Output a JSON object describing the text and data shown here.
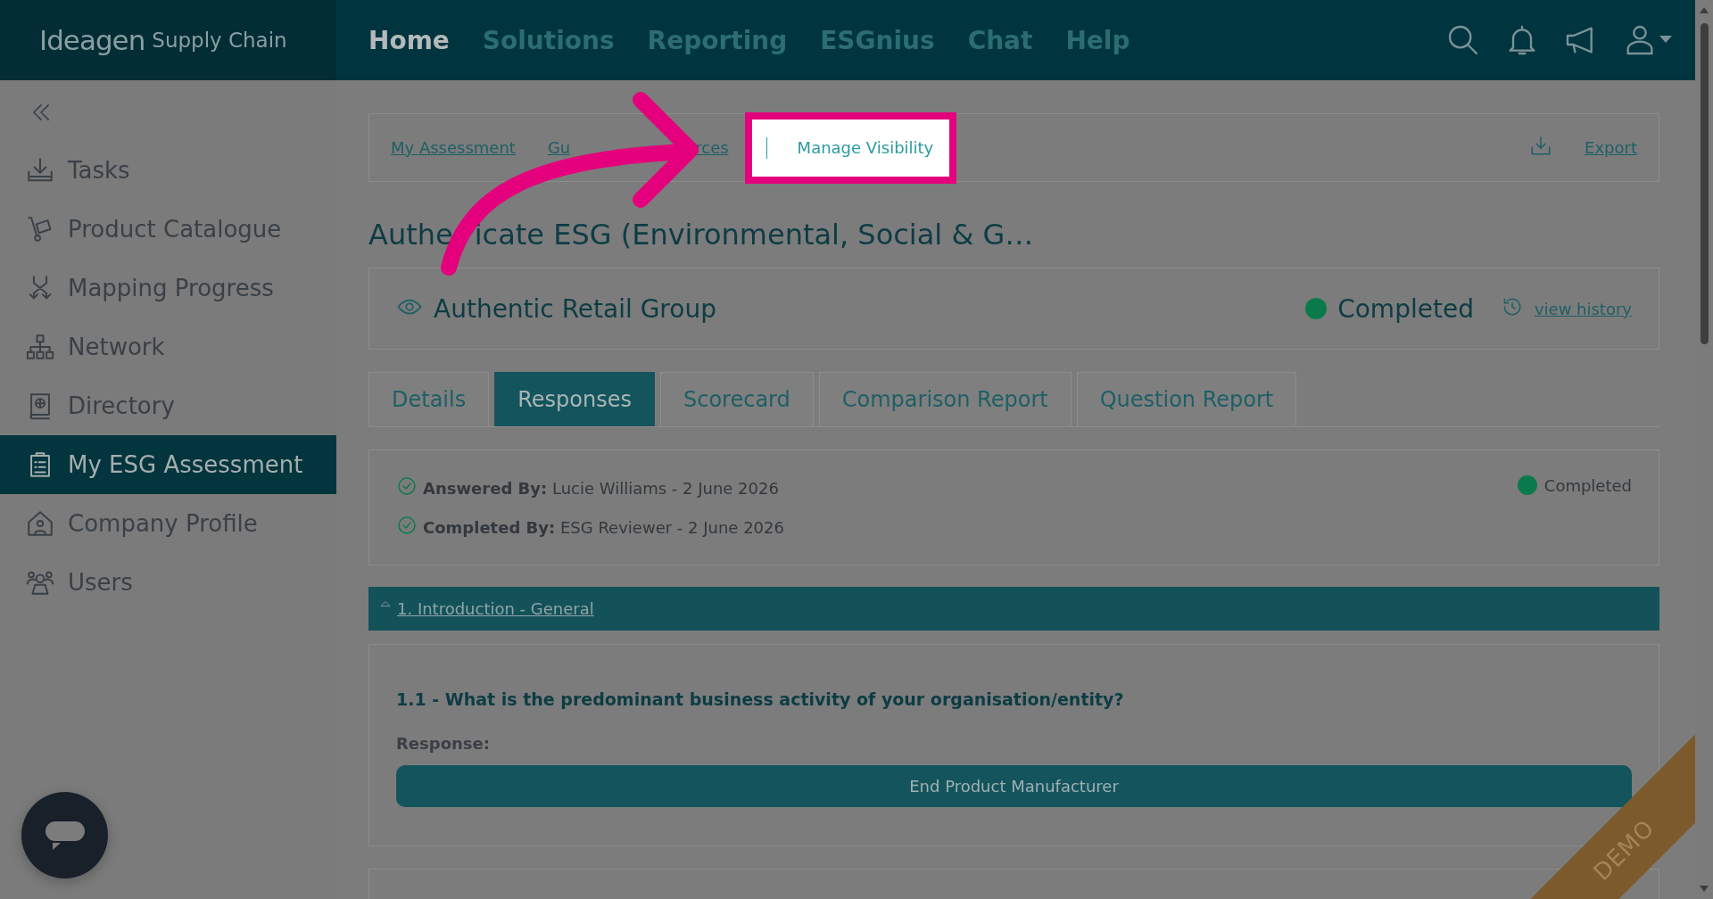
{
  "header": {
    "logo": {
      "brand": "Ideagen",
      "product": "Supply Chain"
    },
    "nav": [
      {
        "label": "Home",
        "selected": true
      },
      {
        "label": "Solutions",
        "selected": false
      },
      {
        "label": "Reporting",
        "selected": false
      },
      {
        "label": "ESGnius",
        "selected": false
      },
      {
        "label": "Chat",
        "selected": false
      },
      {
        "label": "Help",
        "selected": false
      }
    ]
  },
  "sidebar": {
    "items": [
      {
        "label": "Tasks",
        "selected": false
      },
      {
        "label": "Product Catalogue",
        "selected": false
      },
      {
        "label": "Mapping Progress",
        "selected": false
      },
      {
        "label": "Network",
        "selected": false
      },
      {
        "label": "Directory",
        "selected": false
      },
      {
        "label": "My ESG Assessment",
        "selected": true
      },
      {
        "label": "Company Profile",
        "selected": false
      },
      {
        "label": "Users",
        "selected": false
      }
    ]
  },
  "breadcrumb": {
    "items": [
      {
        "label": "My Assessment",
        "highlighted": false
      },
      {
        "label_start": "Gu",
        "label_end": "rces",
        "highlighted": false
      },
      {
        "label": "Manage Visibility",
        "highlighted": true
      }
    ],
    "export": "Export"
  },
  "title": {
    "start": "Authe",
    "end": "icate ESG (Environmental, Social & G…"
  },
  "company": {
    "name": "Authentic Retail Group",
    "status": "Completed",
    "history_link": "view history"
  },
  "tabs": [
    {
      "label": "Details",
      "selected": false
    },
    {
      "label": "Responses",
      "selected": true
    },
    {
      "label": "Scorecard",
      "selected": false
    },
    {
      "label": "Comparison Report",
      "selected": false
    },
    {
      "label": "Question Report",
      "selected": false
    }
  ],
  "responses": {
    "entries": [
      {
        "label": "Answered By:",
        "value": "Lucie Williams - 2 June 2026"
      },
      {
        "label": "Completed By:",
        "value": "ESG Reviewer - 2 June 2026"
      }
    ],
    "status": "Completed"
  },
  "section": {
    "title": "1. Introduction - General",
    "expanded": true
  },
  "question": {
    "title": "1.1 - What is the predominant business activity of your organisation/entity?",
    "response_label": "Response:",
    "answer": "End Product Manufacturer"
  },
  "ribbon": "DEMO"
}
